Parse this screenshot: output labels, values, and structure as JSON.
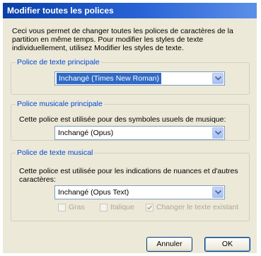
{
  "window": {
    "title": "Modifier toutes les polices"
  },
  "intro_text": "Ceci vous permet de changer toutes les polices de caractères de la partition en même temps. Pour modifier les styles de texte individuellement, utilisez Modifier les styles de texte.",
  "groups": {
    "main_text": {
      "legend": "Police de texte principale",
      "combo_value": "Inchangé (Times New Roman)"
    },
    "main_music": {
      "legend": "Police musicale principale",
      "description": "Cette police est utilisée pour des symboles usuels de musique:",
      "combo_value": "Inchangé (Opus)"
    },
    "music_text": {
      "legend": "Police de texte musical",
      "description": "Cette police est utilisée pour les indications de nuances et d'autres caractères:",
      "combo_value": "Inchangé (Opus Text)",
      "checkboxes": {
        "bold": {
          "label": "Gras",
          "checked": false
        },
        "italic": {
          "label": "Italique",
          "checked": false
        },
        "change_existing": {
          "label": "Changer le texte existant",
          "checked": true
        }
      }
    }
  },
  "buttons": {
    "cancel": "Annuler",
    "ok": "OK"
  },
  "colors": {
    "title_bar": "#0a3fa8",
    "group_legend": "#0046d5",
    "selection": "#316ac5"
  }
}
